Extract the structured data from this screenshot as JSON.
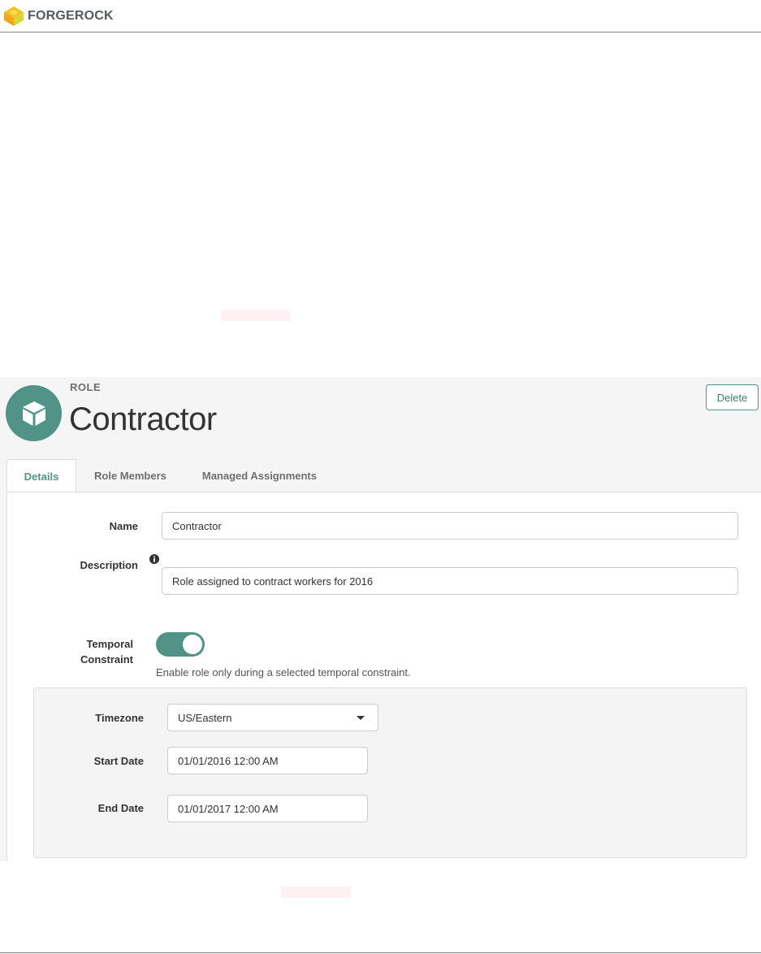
{
  "brand": {
    "name": "FORGEROCK"
  },
  "role": {
    "kicker": "ROLE",
    "title": "Contractor",
    "delete_label": "Delete",
    "icon": "cube-icon",
    "accent_color": "#519387"
  },
  "tabs": [
    {
      "label": "Details",
      "active": true
    },
    {
      "label": "Role Members",
      "active": false
    },
    {
      "label": "Managed Assignments",
      "active": false
    }
  ],
  "form": {
    "name": {
      "label": "Name",
      "value": "Contractor"
    },
    "description": {
      "label": "Description",
      "value": "Role assigned to contract workers for 2016",
      "info_icon": "info-icon"
    },
    "temporal_constraint": {
      "label_line1": "Temporal",
      "label_line2": "Constraint",
      "enabled": true,
      "help": "Enable role only during a selected temporal constraint."
    },
    "timezone": {
      "label": "Timezone",
      "value": "US/Eastern"
    },
    "start_date": {
      "label": "Start Date",
      "value": "01/01/2016 12:00 AM"
    },
    "end_date": {
      "label": "End Date",
      "value": "01/01/2017 12:00 AM"
    }
  }
}
